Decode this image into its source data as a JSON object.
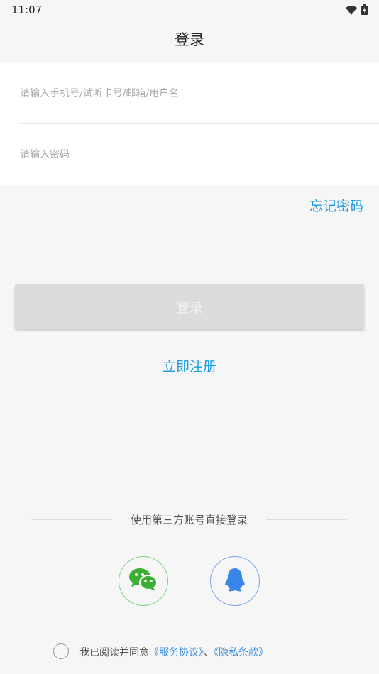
{
  "status_bar": {
    "time": "11:07",
    "icons": [
      "wifi-icon",
      "battery-icon"
    ]
  },
  "header": {
    "title": "登录"
  },
  "form": {
    "account_placeholder": "请输入手机号/试听卡号/邮箱/用户名",
    "account_value": "",
    "password_placeholder": "请输入密码",
    "password_value": ""
  },
  "forgot_password": "忘记密码",
  "login_button": "登录",
  "register": "立即注册",
  "third_party": {
    "label": "使用第三方账号直接登录",
    "providers": [
      {
        "icon": "wechat-icon",
        "color": "#3cb034"
      },
      {
        "icon": "qq-icon",
        "color": "#3a86e8"
      }
    ]
  },
  "agreement": {
    "prefix": "我已阅读并同意",
    "service_link": "《服务协议》",
    "separator": "、",
    "privacy_link": "《隐私条款》",
    "checked": false
  },
  "colors": {
    "accent": "#1a9de0",
    "background": "#f6f6f6",
    "button_disabled": "#dcdcdc"
  }
}
